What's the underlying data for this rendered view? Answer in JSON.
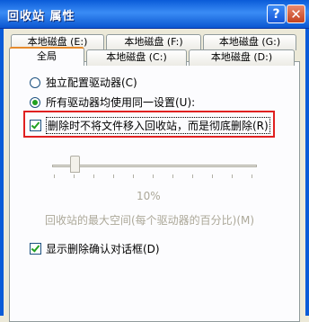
{
  "window": {
    "title": "回收站 属性",
    "help_glyph": "?",
    "close_glyph": "✕"
  },
  "tabs": {
    "row_back": [
      "本地磁盘 (E:)",
      "本地磁盘 (F:)",
      "本地磁盘 (G:)"
    ],
    "row_front": [
      "全局",
      "本地磁盘 (C:)",
      "本地磁盘 (D:)"
    ],
    "active": "全局"
  },
  "options": {
    "independent": {
      "label": "独立配置驱动器(C)",
      "selected": false
    },
    "global": {
      "label": "所有驱动器均使用同一设置(U):",
      "selected": true
    },
    "delete_immediately": {
      "label": "删除时不将文件移入回收站，而是彻底删除(R)",
      "checked": true
    },
    "slider_value": "10%",
    "slider_caption": "回收站的最大空间(每个驱动器的百分比)(M)",
    "confirm_dialog": {
      "label": "显示删除确认对话框(D)",
      "checked": true
    }
  },
  "colors": {
    "highlight_box": "#e02020",
    "title_bar": "#0a5bd8",
    "active_tab_accent": "#e68b2c"
  }
}
